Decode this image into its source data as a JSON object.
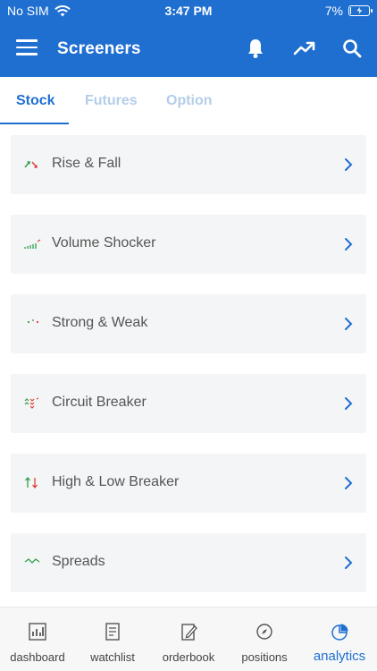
{
  "status_bar": {
    "carrier": "No SIM",
    "time": "3:47 PM",
    "battery_percent": "7%",
    "battery_level": 0.07
  },
  "app_bar": {
    "title": "Screeners",
    "icons": [
      "menu-icon",
      "bell-icon",
      "trending-up-icon",
      "search-icon"
    ]
  },
  "tabs": [
    {
      "label": "Stock",
      "active": true
    },
    {
      "label": "Futures",
      "active": false
    },
    {
      "label": "Option",
      "active": false
    }
  ],
  "screeners": [
    {
      "label": "Rise & Fall",
      "icon": "rise-fall-icon"
    },
    {
      "label": "Volume Shocker",
      "icon": "volume-shocker-icon"
    },
    {
      "label": "Strong & Weak",
      "icon": "strong-weak-icon"
    },
    {
      "label": "Circuit Breaker",
      "icon": "circuit-breaker-icon"
    },
    {
      "label": "High & Low Breaker",
      "icon": "high-low-breaker-icon"
    },
    {
      "label": "Spreads",
      "icon": "spreads-icon"
    }
  ],
  "bottom_nav": [
    {
      "label": "dashboard",
      "icon": "dashboard-icon",
      "active": false
    },
    {
      "label": "watchlist",
      "icon": "watchlist-icon",
      "active": false
    },
    {
      "label": "orderbook",
      "icon": "orderbook-icon",
      "active": false
    },
    {
      "label": "positions",
      "icon": "compass-icon",
      "active": false
    },
    {
      "label": "analytics",
      "icon": "pie-chart-icon",
      "active": true
    }
  ],
  "colors": {
    "primary": "#1f6fd1",
    "up": "#2ca24a",
    "down": "#e0413b",
    "card_bg": "#f4f5f7",
    "tab_inactive": "#b5cde9"
  }
}
